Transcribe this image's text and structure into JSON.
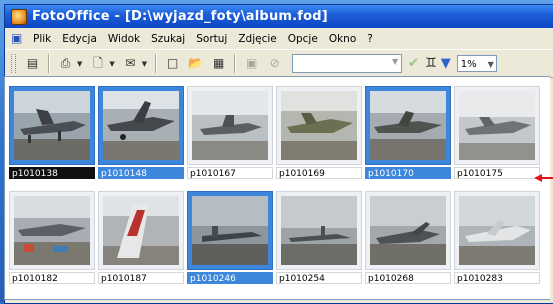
{
  "window": {
    "title": "FotoOffice - [D:\\wyjazd_foty\\album.fod]"
  },
  "menu": {
    "items": [
      "Plik",
      "Edycja",
      "Widok",
      "Szukaj",
      "Sortuj",
      "Zdjęcie",
      "Opcje",
      "Okno",
      "?"
    ]
  },
  "toolbar": {
    "zoom_value": "1%",
    "icons": [
      "album-icon",
      "print-icon",
      "preview-icon",
      "send-icon",
      "new-icon",
      "open-icon",
      "save-icon",
      "disk-icon",
      "stop-icon",
      "check-icon",
      "find-icon",
      "filter-icon"
    ]
  },
  "thumbnails": [
    {
      "name": "p1010138",
      "state": "focused"
    },
    {
      "name": "p1010148",
      "state": "selected"
    },
    {
      "name": "p1010167",
      "state": "normal"
    },
    {
      "name": "p1010169",
      "state": "normal"
    },
    {
      "name": "p1010170",
      "state": "selected"
    },
    {
      "name": "p1010175",
      "state": "normal"
    },
    {
      "name": "p1010182",
      "state": "normal"
    },
    {
      "name": "p1010187",
      "state": "normal"
    },
    {
      "name": "p1010246",
      "state": "selected"
    },
    {
      "name": "p1010254",
      "state": "normal"
    },
    {
      "name": "p1010268",
      "state": "normal"
    },
    {
      "name": "p1010283",
      "state": "normal"
    }
  ],
  "colors": {
    "title_bar": "#0c46c4",
    "selection": "#3c86dc",
    "focus_caption": "#101010",
    "annotation_arrow": "#e0161b"
  }
}
